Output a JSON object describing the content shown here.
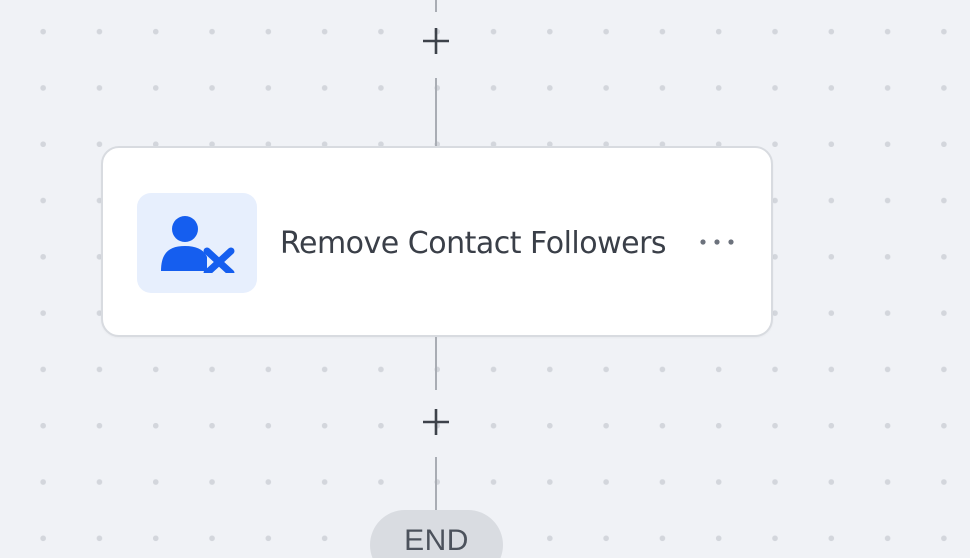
{
  "workflow": {
    "top_add_step": {
      "icon": "plus-icon"
    },
    "action_step": {
      "title": "Remove Contact Followers",
      "icon": "user-remove-icon",
      "icon_color": "#155eef",
      "icon_bg_color": "#e7effd",
      "menu_icon": "more-horizontal-icon"
    },
    "bottom_add_step": {
      "icon": "plus-icon"
    },
    "end_node": {
      "label": "END"
    }
  }
}
